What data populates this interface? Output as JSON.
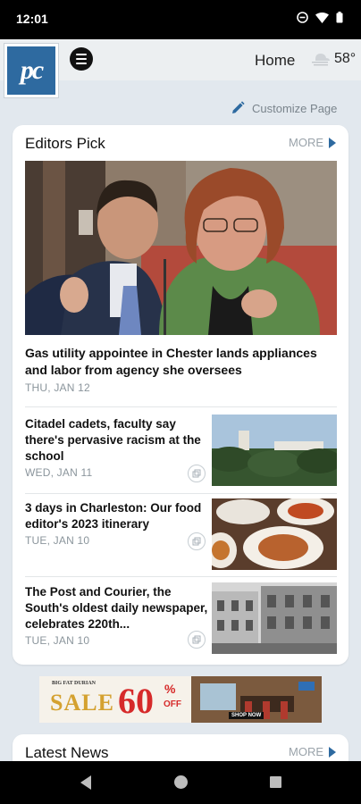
{
  "status_bar": {
    "time": "12:01"
  },
  "header": {
    "logo_text": "pc",
    "title": "Home",
    "temperature": "58°",
    "weather_icon": "cloud-fog-icon",
    "menu_icon": "hamburger-menu-icon"
  },
  "customize": {
    "label": "Customize Page",
    "icon": "pencil-icon"
  },
  "editors_pick": {
    "title": "Editors Pick",
    "more_label": "MORE",
    "hero": {
      "headline": "Gas utility appointee in Chester lands appliances and labor from agency she oversees",
      "date": "THU, JAN 12"
    },
    "articles": [
      {
        "headline": "Citadel cadets, faculty say there's pervasive racism at the school",
        "date": "WED, JAN 11"
      },
      {
        "headline": "3 days in Charleston: Our food editor's 2023 itinerary",
        "date": "TUE, JAN 10"
      },
      {
        "headline": "The Post and Courier, the South's oldest daily newspaper, celebrates 220th...",
        "date": "TUE, JAN 10"
      }
    ]
  },
  "ad": {
    "brand": "BIG FAT DURIAN",
    "sale_word": "SALE",
    "discount": "60",
    "percent": "%",
    "off": "OFF",
    "cta": "SHOP NOW"
  },
  "latest_news": {
    "title": "Latest News",
    "more_label": "MORE"
  },
  "colors": {
    "accent": "#2e6aa0",
    "background": "#e2e8ee",
    "muted": "#8b959c"
  }
}
